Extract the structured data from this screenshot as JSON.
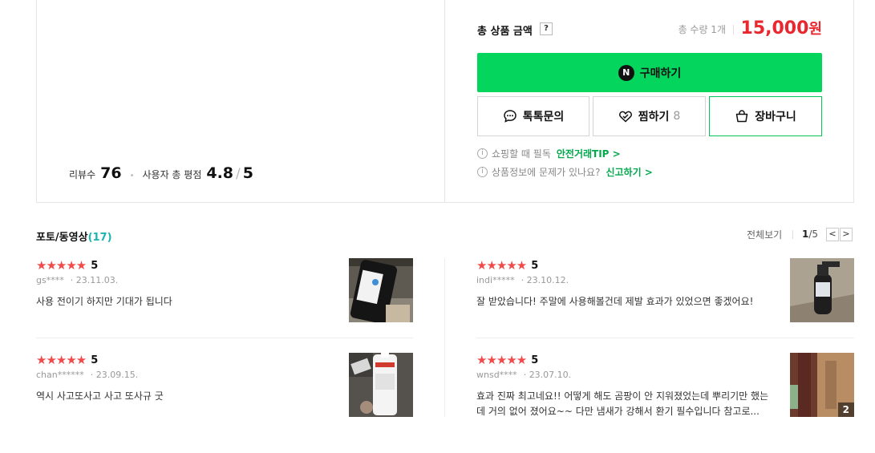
{
  "rating_summary": {
    "review_count_label": "리뷰수",
    "review_count": "76",
    "avg_label": "사용자 총 평점",
    "avg": "4.8",
    "max": "5"
  },
  "order": {
    "total_label": "총 상품 금액",
    "help": "?",
    "quantity": "총 수량 1개",
    "price_value": "15,000",
    "price_unit": "원",
    "buy_badge": "N",
    "buy_label": "구매하기",
    "talk_label": "톡톡문의",
    "zzim_label": "찜하기",
    "zzim_count": "8",
    "cart_label": "장바구니",
    "info1_text": "쇼핑할 때 필독",
    "info1_link": "안전거래TIP >",
    "info2_text": "상품정보에 문제가 있나요?",
    "info2_link": "신고하기 >"
  },
  "photos": {
    "title": "포토/동영상",
    "count": "(17)",
    "view_all": "전체보기",
    "page_current": "1",
    "page_total": "/5",
    "prev": "<",
    "next": ">"
  },
  "reviews": [
    {
      "stars": "★★★★★",
      "score": "5",
      "user": "gs****",
      "date": "23.11.03.",
      "text": "사용 전이기 하지만 기대가 됩니다"
    },
    {
      "stars": "★★★★★",
      "score": "5",
      "user": "indi*****",
      "date": "23.10.12.",
      "text": "잘 받았습니다! 주말에 사용해볼건데 제발 효과가 있었으면 좋겠어요!"
    },
    {
      "stars": "★★★★★",
      "score": "5",
      "user": "chan******",
      "date": "23.09.15.",
      "text": "역시 사고또사고 사고 또사규 굿"
    },
    {
      "stars": "★★★★★",
      "score": "5",
      "user": "wnsd****",
      "date": "23.07.10.",
      "text": "효과 진짜 최고네요!! 어떻게 해도 곰팡이 안 지워졌었는데 뿌리기만 했는데 거의 없어 졌어요~~ 다만 냄새가 강해서 환기 필수입니다 참고로...",
      "photo_count": "2"
    }
  ],
  "colors": {
    "buy_green": "#03d55d",
    "price_red": "#e8272f",
    "star_red": "#f04b4b",
    "count_teal": "#19b6b0",
    "link_green": "#03a94d"
  }
}
